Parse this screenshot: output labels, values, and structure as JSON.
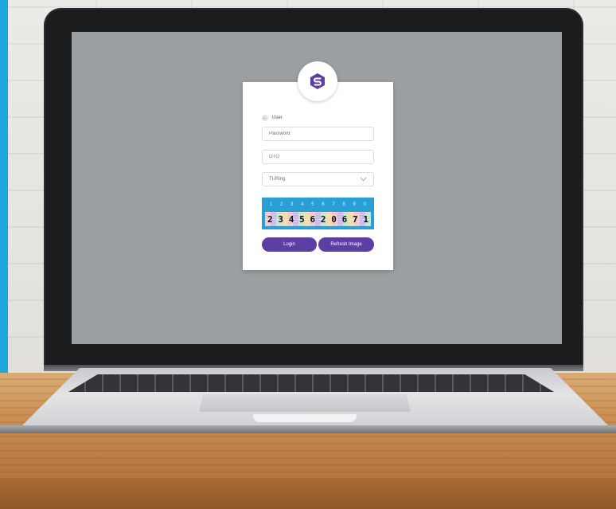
{
  "login": {
    "user_label": "User",
    "password_placeholder": "Password",
    "otp_placeholder": "OTO",
    "selected_option": "TURing",
    "login_button": "Login",
    "refresh_button": "Refresh Image"
  },
  "captcha": {
    "numbers": [
      "1",
      "2",
      "3",
      "4",
      "5",
      "6",
      "7",
      "8",
      "9",
      "0"
    ],
    "code": [
      "2",
      "3",
      "4",
      "5",
      "6",
      "2",
      "0",
      "6",
      "7",
      "1"
    ]
  },
  "colors": {
    "accent": "#5b3fa3",
    "captcha_bg": "#2a9fd6",
    "screen_bg": "#9b9fa1"
  },
  "icons": {
    "logo": "shield-s-logo-icon",
    "back": "back-arrow-icon",
    "dropdown": "chevron-down-icon"
  }
}
